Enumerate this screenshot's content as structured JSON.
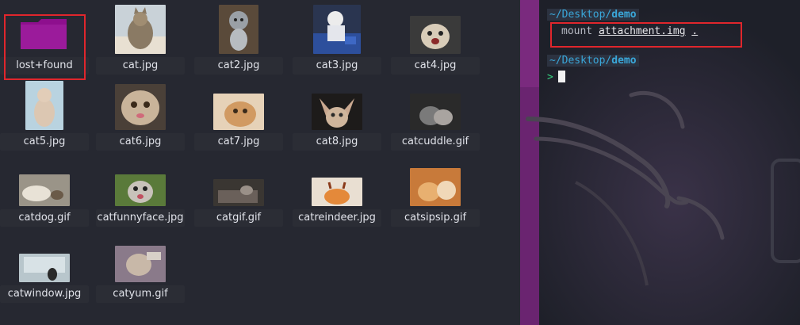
{
  "file_manager": {
    "items": [
      {
        "name": "lost+found",
        "type": "folder"
      },
      {
        "name": "cat.jpg"
      },
      {
        "name": "cat2.jpg"
      },
      {
        "name": "cat3.jpg"
      },
      {
        "name": "cat4.jpg"
      },
      {
        "name": "cat5.jpg"
      },
      {
        "name": "cat6.jpg"
      },
      {
        "name": "cat7.jpg"
      },
      {
        "name": "cat8.jpg"
      },
      {
        "name": "catcuddle.gif"
      },
      {
        "name": "catdog.gif"
      },
      {
        "name": "catfunnyface.jpg"
      },
      {
        "name": "catgif.gif"
      },
      {
        "name": "catreindeer.jpg"
      },
      {
        "name": "catsipsip.gif"
      },
      {
        "name": "catwindow.jpg"
      },
      {
        "name": "catyum.gif"
      }
    ],
    "folder_color": "#8e0f8e"
  },
  "terminal": {
    "prompt1_tilde": "~/Desktop/",
    "prompt1_dir": "demo",
    "command_word": "mount",
    "command_arg1": "attachment.img",
    "command_arg2": ".",
    "prompt2_tilde": "~/Desktop/",
    "prompt2_dir": "demo",
    "prompt_arrow": ">"
  },
  "colors": {
    "highlight": "#e0262c",
    "prompt": "#3aa7d9",
    "arrow": "#35d07f",
    "wallpaper_purple": "#7a2a7e"
  }
}
